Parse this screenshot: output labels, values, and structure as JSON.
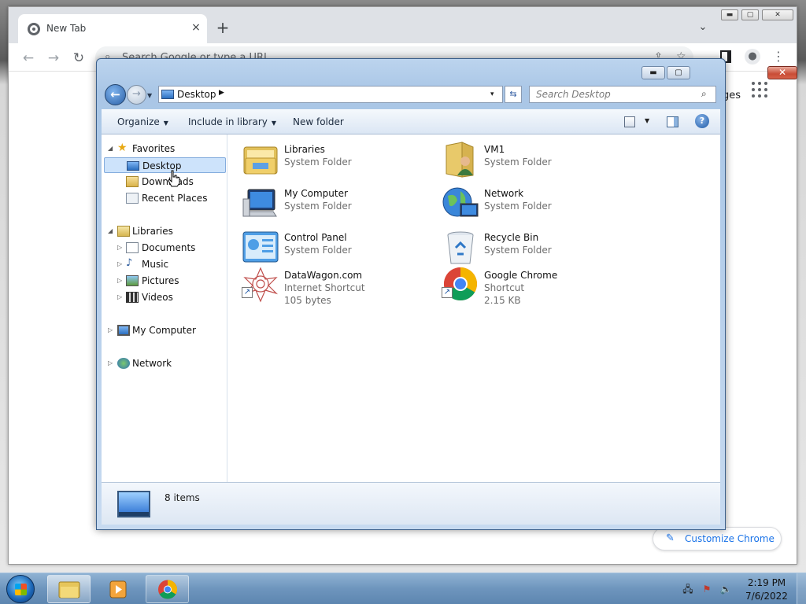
{
  "chrome": {
    "tab_title": "New Tab",
    "tab_close": "×",
    "new_tab": "+",
    "tab_list": "⌄",
    "omnibox_placeholder": "Search Google or type a URL",
    "images_link": "ges",
    "customize_label": "Customize Chrome",
    "window_buttons": {
      "minimize": "▬",
      "maximize": "▢",
      "close": "✕"
    }
  },
  "explorer": {
    "address": {
      "location": "Desktop",
      "separator": "▶",
      "dropdown": "▾"
    },
    "search_placeholder": "Search Desktop",
    "window_buttons": {
      "minimize": "▬",
      "maximize": "▢",
      "close": "✕"
    },
    "command_bar": {
      "organize": "Organize",
      "include_in_library": "Include in library",
      "new_folder": "New folder"
    },
    "nav": {
      "favorites": {
        "label": "Favorites",
        "items": [
          "Desktop",
          "Downloads",
          "Recent Places"
        ]
      },
      "libraries": {
        "label": "Libraries",
        "items": [
          "Documents",
          "Music",
          "Pictures",
          "Videos"
        ]
      },
      "my_computer": "My Computer",
      "network": "Network"
    },
    "items": [
      {
        "name": "Libraries",
        "type": "System Folder",
        "icon": "libraries-icon"
      },
      {
        "name": "VM1",
        "type": "System Folder",
        "icon": "user-folder-icon"
      },
      {
        "name": "My Computer",
        "type": "System Folder",
        "icon": "computer-icon"
      },
      {
        "name": "Network",
        "type": "System Folder",
        "icon": "network-icon"
      },
      {
        "name": "Control Panel",
        "type": "System Folder",
        "icon": "control-panel-icon"
      },
      {
        "name": "Recycle Bin",
        "type": "System Folder",
        "icon": "recycle-bin-icon"
      },
      {
        "name": "DataWagon.com",
        "type": "Internet Shortcut",
        "size": "105 bytes",
        "icon": "web-shortcut-icon"
      },
      {
        "name": "Google Chrome",
        "type": "Shortcut",
        "size": "2.15 KB",
        "icon": "chrome-icon"
      }
    ],
    "status": {
      "count": "8 items"
    }
  },
  "taskbar": {
    "time": "2:19 PM",
    "date": "7/6/2022"
  },
  "colors": {
    "selection": "#cde3fb",
    "chrome_accent": "#1a73e8",
    "taskbar": "#6e95bd"
  }
}
